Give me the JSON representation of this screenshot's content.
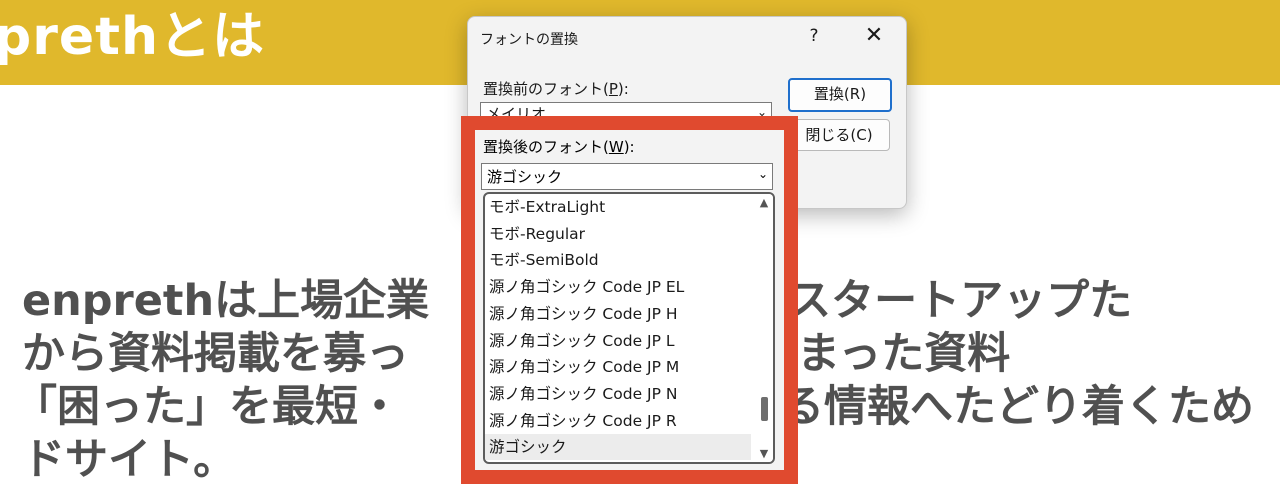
{
  "header": {
    "title": "prethとは"
  },
  "article": {
    "lines": [
      "enprethは上場企業・ベンチャー・スタートアップが",
      "から資料掲載を募ってノウハウが詰まった資料",
      "「困った」を最短・ 必要な情報へたどり着くため",
      "ドサイト。"
    ],
    "visible_fragments": [
      {
        "left": "enprethは上場企業",
        "right": "ャー・スタートアップた"
      },
      {
        "left": "から資料掲載を募っ",
        "right": "ノウハウが詰まった資料"
      },
      {
        "left": "「困った」を最短・",
        "right": "る情報へたどり着くため"
      },
      {
        "left": "ドサイト。",
        "right": ""
      }
    ]
  },
  "dialog": {
    "title": "フォントの置換",
    "help_label": "?",
    "close_label": "✕",
    "before_label_prefix": "置換前のフォント(",
    "before_label_key": "P",
    "before_label_suffix": "):",
    "before_value": "メイリオ",
    "after_label_prefix": "置換後のフォント(",
    "after_label_key": "W",
    "after_label_suffix": "):",
    "after_value": "游ゴシック",
    "replace_button": "置換(R)",
    "close_button": "閉じる(C)",
    "font_list": [
      "モボ-ExtraLight",
      "モボ-Regular",
      "モボ-SemiBold",
      "源ノ角ゴシック Code JP EL",
      "源ノ角ゴシック Code JP H",
      "源ノ角ゴシック Code JP L",
      "源ノ角ゴシック Code JP M",
      "源ノ角ゴシック Code JP N",
      "源ノ角ゴシック Code JP R",
      "游ゴシック"
    ],
    "selected_font": "游ゴシック"
  },
  "colors": {
    "header_band": "#e0b82c",
    "highlight_frame": "#e04a2f",
    "primary_button_border": "#1f6fcc"
  },
  "icons": {
    "dropdown": "chevron-down-icon",
    "scroll_up": "triangle-up-icon",
    "scroll_down": "triangle-down-icon"
  }
}
